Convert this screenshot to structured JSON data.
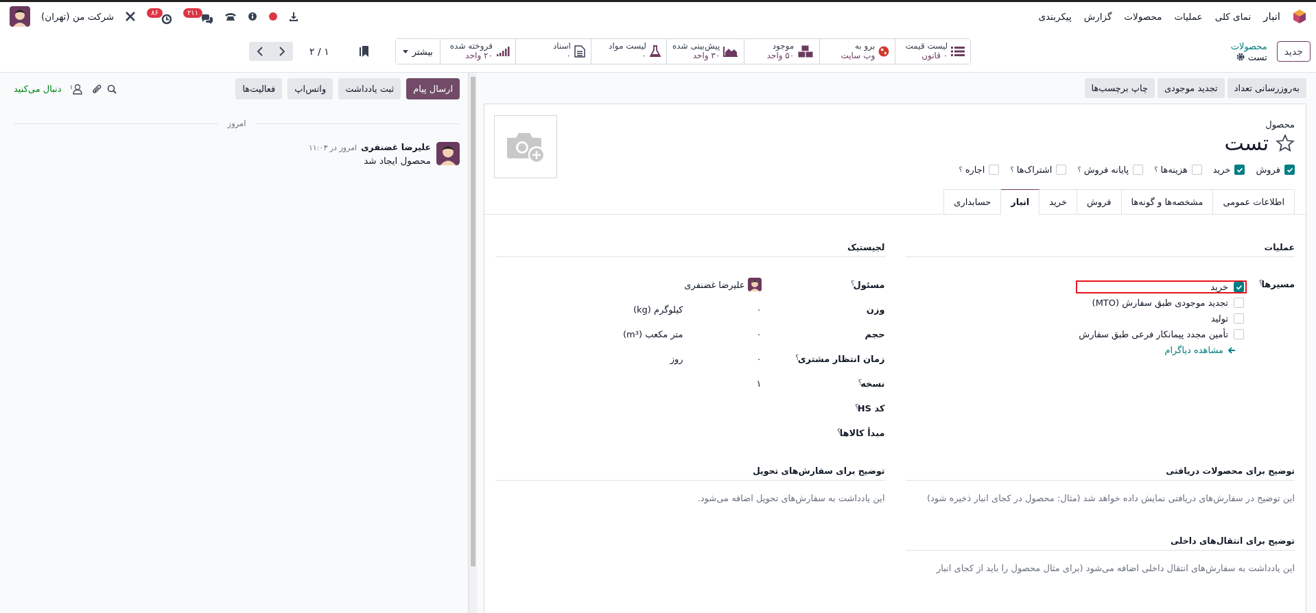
{
  "navbar": {
    "app_name": "انبار",
    "menus": [
      "نمای کلی",
      "عملیات",
      "محصولات",
      "گزارش",
      "پیکربندی"
    ],
    "company": "شرکت من (تهران)",
    "activity_count": "۸۶",
    "message_count": "۲۱۱"
  },
  "control_panel": {
    "new_button": "جدید",
    "breadcrumb": "محصولات",
    "record_name": "تست",
    "stat_buttons": [
      {
        "kind": "pricelist",
        "line1": "لیست قیمت",
        "line2": "۰ قانون"
      },
      {
        "kind": "website",
        "line1": "برو به",
        "line2": "وب سایت"
      },
      {
        "kind": "on_hand",
        "line1": "موجود",
        "line2": "۵۰ واحد"
      },
      {
        "kind": "forecast",
        "line1": "پیش‌بینی شده",
        "line2": "۳۰ واحد"
      },
      {
        "kind": "bom",
        "line1": "لیست مواد",
        "line2": "۰"
      },
      {
        "kind": "documents",
        "line1": "اسناد",
        "line2": "۰"
      },
      {
        "kind": "sold",
        "line1": "فروخته شده",
        "line2": "۲۰ واحد"
      }
    ],
    "more": "بیشتر",
    "pager": "۱ / ۲"
  },
  "form": {
    "action_buttons": [
      "به‌روزرسانی تعداد",
      "تجدید موجودی",
      "چاپ برچسب‌ها"
    ],
    "label": "محصول",
    "title": "تست",
    "starred": false,
    "options": [
      {
        "label": "فروش",
        "checked": true
      },
      {
        "label": "خرید",
        "checked": true
      },
      {
        "label": "هزینه‌ها",
        "checked": false,
        "tip": "؟"
      },
      {
        "label": "پایانه فروش",
        "checked": false,
        "tip": "؟"
      },
      {
        "label": "اشتراک‌ها",
        "checked": false,
        "tip": "؟"
      },
      {
        "label": "اجاره",
        "checked": false,
        "tip": "؟"
      }
    ],
    "tabs": [
      {
        "label": "اطلاعات عمومی",
        "selected": false
      },
      {
        "label": "مشخصه‌ها و گونه‌ها",
        "selected": false
      },
      {
        "label": "فروش",
        "selected": false
      },
      {
        "label": "خرید",
        "selected": false
      },
      {
        "label": "انبار",
        "selected": true
      },
      {
        "label": "حسابداری",
        "selected": false
      }
    ],
    "operations": {
      "title": "عملیات",
      "routes_label": "مسیرها",
      "routes_tip": "؟",
      "routes": [
        {
          "label": "خرید",
          "checked": true,
          "highlighted": true
        },
        {
          "label": "تجدید موجودی طبق سفارش (MTO)",
          "checked": false,
          "highlighted": false
        },
        {
          "label": "تولید",
          "checked": false,
          "highlighted": false
        },
        {
          "label": "تأمین مجدد پیمانکار فرعی طبق سفارش",
          "checked": false,
          "highlighted": false
        }
      ],
      "diagram_link": "مشاهده دیاگرام"
    },
    "logistics": {
      "title": "لجیستیک",
      "fields": [
        {
          "kind": "user",
          "label": "مسئول",
          "tip": "؟",
          "value": "علیرضا غضنفری"
        },
        {
          "kind": "number",
          "label": "وزن",
          "value": "۰",
          "unit": "کیلوگرم (kg)"
        },
        {
          "kind": "number",
          "label": "حجم",
          "value": "۰",
          "unit": "متر مکعب (m³)"
        },
        {
          "kind": "number",
          "label": "زمان انتظار مشتری",
          "tip": "؟",
          "value": "۰",
          "unit": "روز"
        },
        {
          "kind": "number",
          "label": "نسخه",
          "tip": "؟",
          "value": "۱"
        },
        {
          "kind": "empty",
          "label": "کد HS",
          "tip": "؟"
        },
        {
          "kind": "empty",
          "label": "مبدأ کالاها",
          "tip": "؟"
        }
      ]
    },
    "notes": [
      {
        "title": "توضیح برای محصولات دریافتی",
        "placeholder": "این توضیح در سفارش‌های دریافتی نمایش داده خواهد شد (مثال: محصول در کجای انبار ذخیره شود)"
      },
      {
        "title": "توضیح برای سفارش‌های تحویل",
        "placeholder": "این یادداشت به سفارش‌های تحویل اضافه می‌شود."
      },
      {
        "title": "توضیح برای انتقال‌های داخلی",
        "placeholder": "این یادداشت به سفارش‌های انتقال داخلی اضافه می‌شود (برای مثال محصول را باید از کجای انبار"
      }
    ]
  },
  "chatter": {
    "buttons": [
      {
        "label": "ارسال پیام",
        "primary": true
      },
      {
        "label": "ثبت یادداشت",
        "primary": false
      },
      {
        "label": "واتس‌اپ",
        "primary": false
      },
      {
        "label": "فعالیت‌ها",
        "primary": false
      }
    ],
    "followers_count": "۱",
    "follow_status": "دنبال می‌کنید",
    "date_separator": "امروز",
    "messages": [
      {
        "author": "علیرضا غضنفری",
        "time": "امروز در ۱۱:۰۳",
        "body": "محصول ایجاد شد"
      }
    ]
  }
}
